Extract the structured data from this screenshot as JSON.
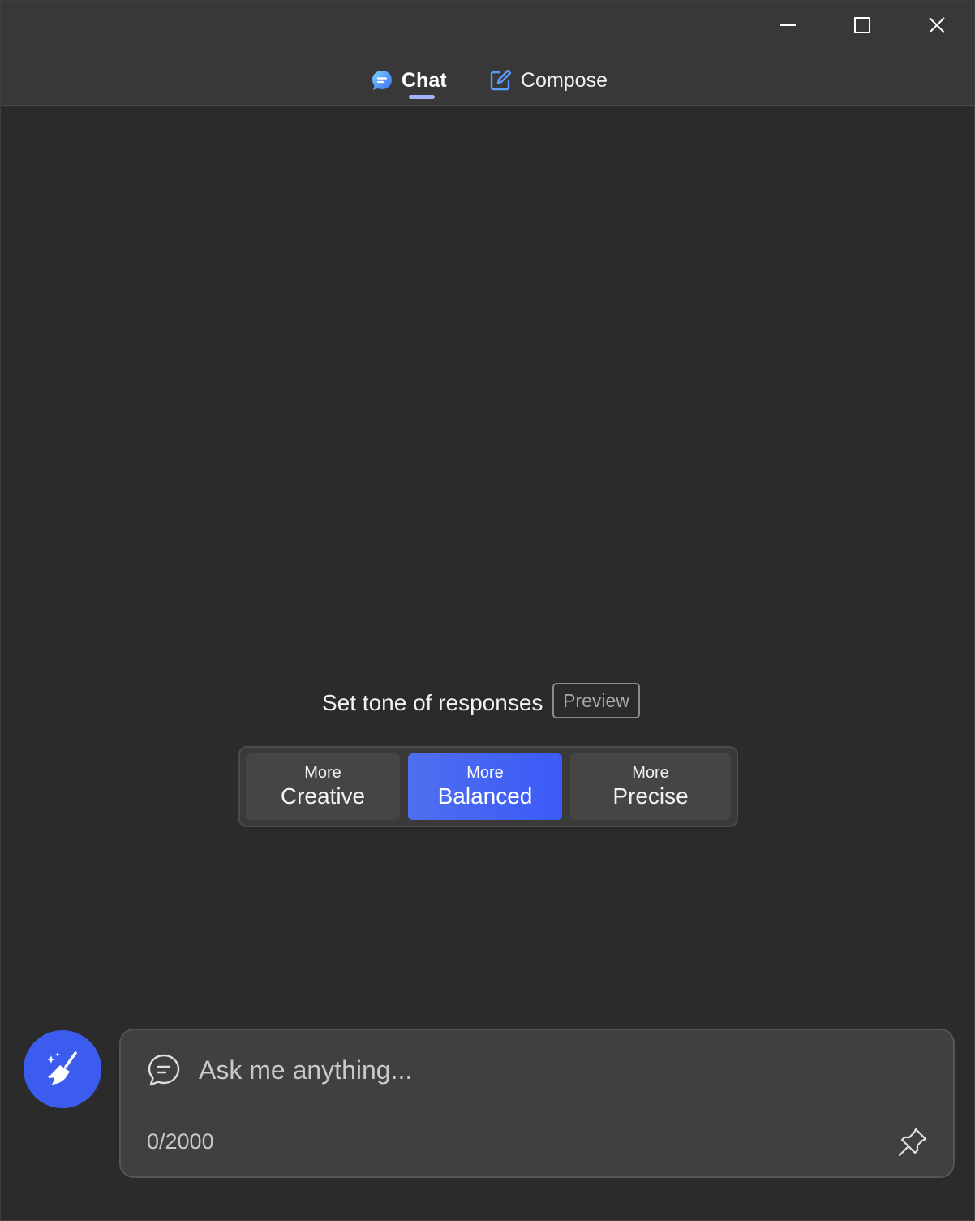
{
  "window_controls": {
    "minimize": "minimize-icon",
    "maximize": "maximize-icon",
    "close": "close-icon"
  },
  "tabs": [
    {
      "label": "Chat",
      "icon": "chat-bubble-icon",
      "active": true
    },
    {
      "label": "Compose",
      "icon": "compose-icon",
      "active": false
    }
  ],
  "tone": {
    "heading": "Set tone of responses",
    "badge": "Preview",
    "options": [
      {
        "small": "More",
        "big": "Creative",
        "selected": false
      },
      {
        "small": "More",
        "big": "Balanced",
        "selected": true
      },
      {
        "small": "More",
        "big": "Precise",
        "selected": false
      }
    ]
  },
  "composer": {
    "placeholder": "Ask me anything...",
    "char_count": "0/2000",
    "new_topic_icon": "broom-icon",
    "input_icon": "chat-outline-icon",
    "pin_icon": "pin-icon"
  },
  "colors": {
    "accent": "#3c5cf0",
    "tab_underline": "#a4b3ff",
    "background": "#2b2b2b",
    "titlebar": "#383838"
  }
}
